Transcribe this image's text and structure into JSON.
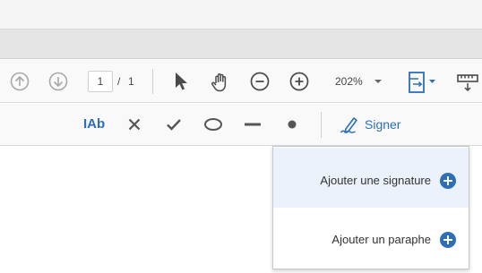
{
  "toolbar": {
    "page_current": "1",
    "page_separator": "/",
    "page_total": "1",
    "zoom_value": "202%",
    "icons": [
      "arrow-up-circle-icon",
      "arrow-down-circle-icon",
      "pointer-icon",
      "hand-icon",
      "zoom-out-icon",
      "zoom-in-icon",
      "fit-page-icon",
      "ruler-icon"
    ]
  },
  "fill_sign_bar": {
    "text_tool_label": "IAb",
    "sign_label": "Signer",
    "icons": [
      "cross-icon",
      "check-icon",
      "ellipse-icon",
      "line-icon",
      "dot-icon",
      "pen-sign-icon"
    ]
  },
  "sign_menu": {
    "items": [
      {
        "label": "Ajouter une signature",
        "icon": "plus-circle-icon"
      },
      {
        "label": "Ajouter un paraphe",
        "icon": "plus-circle-icon"
      }
    ]
  },
  "colors": {
    "accent": "#2c6fb8",
    "menu_selected_bg": "#ebf2fb"
  }
}
